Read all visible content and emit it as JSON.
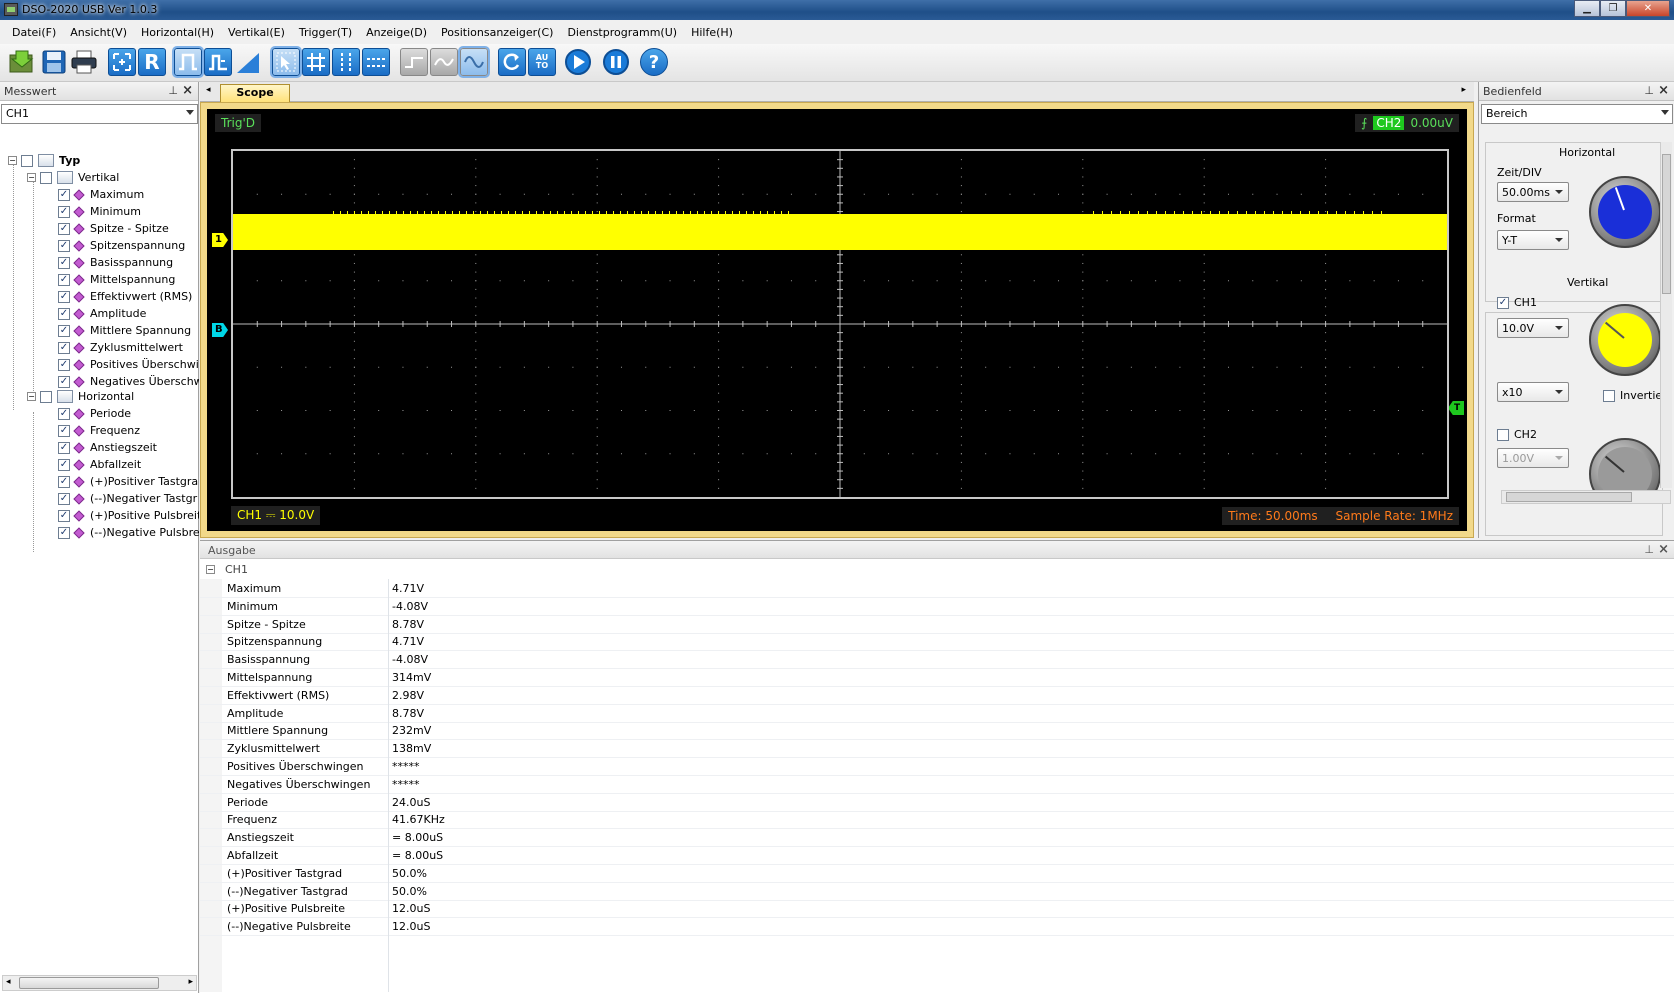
{
  "window": {
    "title": "DSO-2020 USB Ver 1.0.3"
  },
  "menu": [
    "Datei(F)",
    "Ansicht(V)",
    "Horizontal(H)",
    "Vertikal(E)",
    "Trigger(T)",
    "Anzeige(D)",
    "Positionsanzeiger(C)",
    "Dienstprogramm(U)",
    "Hilfe(H)"
  ],
  "toolbar": {
    "r_label": "R",
    "auto_label": "AU TO",
    "help_label": "?"
  },
  "left_panel": {
    "title": "Messwert",
    "channel": "CH1",
    "tree_root": "Typ",
    "vertikal_label": "Vertikal",
    "vertikal_items": [
      "Maximum",
      "Minimum",
      "Spitze - Spitze",
      "Spitzenspannung",
      "Basisspannung",
      "Mittelspannung",
      "Effektivwert (RMS)",
      "Amplitude",
      "Mittlere Spannung",
      "Zyklusmittelwert",
      "Positives Überschwi",
      "Negatives Überschw"
    ],
    "horizontal_label": "Horizontal",
    "horizontal_items": [
      "Periode",
      "Frequenz",
      "Anstiegszeit",
      "Abfallzeit",
      "(+)Positiver Tastgra",
      "(--)Negativer Tastgr",
      "(+)Positive Pulsbreit",
      "(--)Negative Pulsbre"
    ]
  },
  "scope": {
    "tab_label": "Scope",
    "trig_status": "Trig'D",
    "trig_channel": "CH2",
    "trig_level": "0.00uV",
    "ch1_marker": "1",
    "b_marker": "B",
    "t_marker": "T",
    "ch1_readout": "CH1 ⎓ 10.0V",
    "time": "Time: 50.00ms",
    "sample_rate": "Sample Rate: 1MHz",
    "trace_color": "#ffff00"
  },
  "right_panel": {
    "title": "Bedienfeld",
    "mode": "Bereich",
    "horizontal_title": "Horizontal",
    "zeit_label": "Zeit/DIV",
    "zeit_value": "50.00ms",
    "format_label": "Format",
    "format_value": "Y-T",
    "vertikal_title": "Vertikal",
    "ch1_label": "CH1",
    "ch1_checked": true,
    "ch1_volts": "10.0V",
    "ch1_probe": "x10",
    "invert_label": "Invertier",
    "ch2_label": "CH2",
    "ch2_checked": false,
    "ch2_volts": "1.00V",
    "knob_colors": {
      "time": "#1a2fd8",
      "ch1": "#ffff00",
      "ch2": "#9a9a9a"
    }
  },
  "output": {
    "title": "Ausgabe",
    "group": "CH1",
    "rows": [
      {
        "k": "Maximum",
        "v": "4.71V"
      },
      {
        "k": "Minimum",
        "v": "-4.08V"
      },
      {
        "k": "Spitze - Spitze",
        "v": "8.78V"
      },
      {
        "k": "Spitzenspannung",
        "v": "4.71V"
      },
      {
        "k": "Basisspannung",
        "v": "-4.08V"
      },
      {
        "k": "Mittelspannung",
        "v": "314mV"
      },
      {
        "k": "Effektivwert (RMS)",
        "v": "2.98V"
      },
      {
        "k": "Amplitude",
        "v": "8.78V"
      },
      {
        "k": "Mittlere Spannung",
        "v": "232mV"
      },
      {
        "k": "Zyklusmittelwert",
        "v": "138mV"
      },
      {
        "k": "Positives Überschwingen",
        "v": "*****"
      },
      {
        "k": "Negatives Überschwingen",
        "v": "*****"
      },
      {
        "k": "Periode",
        "v": "24.0uS"
      },
      {
        "k": "Frequenz",
        "v": "41.67KHz"
      },
      {
        "k": "Anstiegszeit",
        "v": "= 8.00uS"
      },
      {
        "k": "Abfallzeit",
        "v": "= 8.00uS"
      },
      {
        "k": "(+)Positiver Tastgrad",
        "v": "50.0%"
      },
      {
        "k": "(--)Negativer Tastgrad",
        "v": "50.0%"
      },
      {
        "k": "(+)Positive Pulsbreite",
        "v": "12.0uS"
      },
      {
        "k": "(--)Negative Pulsbreite",
        "v": "12.0uS"
      }
    ]
  }
}
